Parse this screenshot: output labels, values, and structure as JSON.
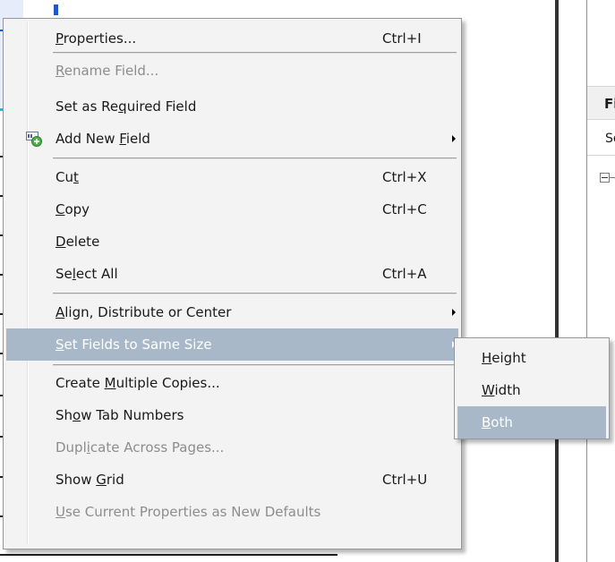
{
  "context_menu": {
    "items": [
      {
        "pre": "",
        "acc": "P",
        "post": "roperties...",
        "shortcut": "Ctrl+I",
        "disabled": false
      },
      {
        "pre": "",
        "acc": "R",
        "post": "ename Field...",
        "shortcut": "",
        "disabled": true
      },
      {
        "pre": "Set as Re",
        "acc": "q",
        "post": "uired Field",
        "shortcut": "",
        "disabled": false
      },
      {
        "pre": "Add New ",
        "acc": "F",
        "post": "ield",
        "shortcut": "",
        "disabled": false,
        "icon": "add-text-field-icon",
        "submenu": true
      },
      {
        "pre": "Cu",
        "acc": "t",
        "post": "",
        "shortcut": "Ctrl+X",
        "disabled": false
      },
      {
        "pre": "",
        "acc": "C",
        "post": "opy",
        "shortcut": "Ctrl+C",
        "disabled": false
      },
      {
        "pre": "",
        "acc": "D",
        "post": "elete",
        "shortcut": "",
        "disabled": false
      },
      {
        "pre": "Se",
        "acc": "l",
        "post": "ect All",
        "shortcut": "Ctrl+A",
        "disabled": false
      },
      {
        "pre": "",
        "acc": "A",
        "post": "lign, Distribute or Center",
        "shortcut": "",
        "disabled": false,
        "submenu": true
      },
      {
        "pre": "",
        "acc": "S",
        "post": "et Fields to Same Size",
        "shortcut": "",
        "disabled": false,
        "submenu": true,
        "highlighted": true
      },
      {
        "pre": "Create ",
        "acc": "M",
        "post": "ultiple Copies...",
        "shortcut": "",
        "disabled": false
      },
      {
        "pre": "Sh",
        "acc": "o",
        "post": "w Tab Numbers",
        "shortcut": "",
        "disabled": false
      },
      {
        "pre": "Dupl",
        "acc": "i",
        "post": "cate Across Pages...",
        "shortcut": "",
        "disabled": true
      },
      {
        "pre": "Show ",
        "acc": "G",
        "post": "rid",
        "shortcut": "Ctrl+U",
        "disabled": false
      },
      {
        "pre": "",
        "acc": "U",
        "post": "se Current Properties as New Defaults",
        "shortcut": "",
        "disabled": true
      }
    ]
  },
  "submenu": {
    "items": [
      {
        "pre": "",
        "acc": "H",
        "post": "eight",
        "highlighted": false
      },
      {
        "pre": "",
        "acc": "W",
        "post": "idth",
        "highlighted": false
      },
      {
        "pre": "",
        "acc": "B",
        "post": "oth",
        "highlighted": true
      }
    ]
  },
  "right_panel": {
    "header": "Fi",
    "sort_label": "So"
  },
  "colors": {
    "menu_background": "#f3f3f3",
    "highlight": "#a9b8c9",
    "disabled_text": "#8d8d8d",
    "field_selection": "#1f57c8",
    "field_underline": "#22b3e4"
  }
}
